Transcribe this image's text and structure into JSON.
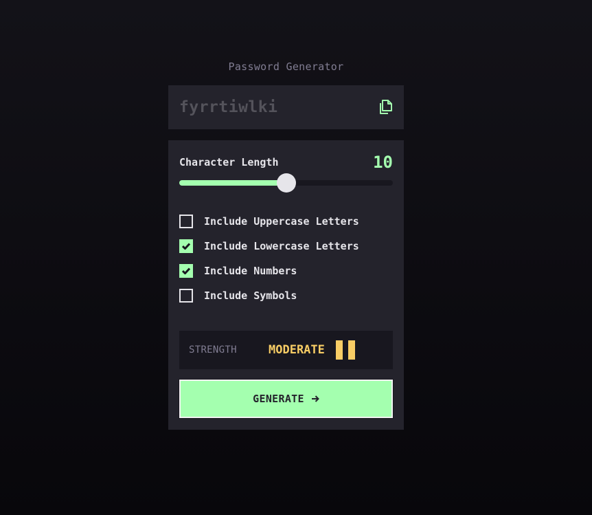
{
  "app": {
    "title": "Password Generator"
  },
  "output": {
    "password": "fyrrtiwlki",
    "copy_icon": "copy-icon"
  },
  "length": {
    "label": "Character Length",
    "value": "10",
    "min": 0,
    "max": 20,
    "current": 10
  },
  "options": [
    {
      "label": "Include Uppercase Letters",
      "checked": false
    },
    {
      "label": "Include Lowercase Letters",
      "checked": true
    },
    {
      "label": "Include Numbers",
      "checked": true
    },
    {
      "label": "Include Symbols",
      "checked": false
    }
  ],
  "strength": {
    "label": "STRENGTH",
    "value": "MODERATE",
    "bars_filled": 2,
    "color": "#F8CD65"
  },
  "generate": {
    "label": "GENERATE",
    "icon": "arrow-right-icon"
  },
  "colors": {
    "accent": "#A4FFAF",
    "panel": "#24232C",
    "dark": "#18171F",
    "muted": "#817D92",
    "text": "#E6E5EA"
  }
}
